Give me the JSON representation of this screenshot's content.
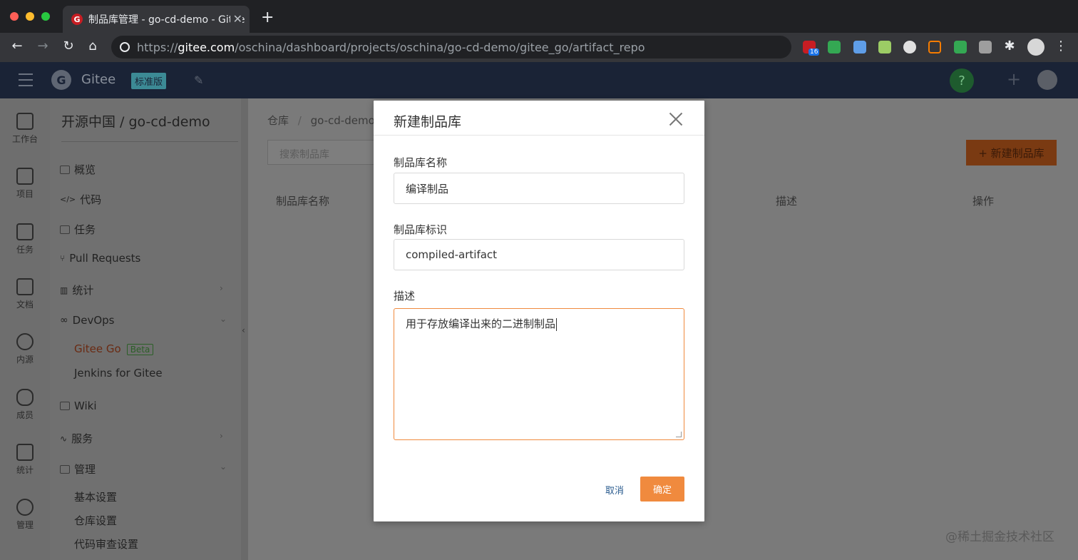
{
  "browser": {
    "tab_title": "制品库管理 - go-cd-demo - Gitee",
    "url_prefix": "https://",
    "url_host": "gitee.com",
    "url_path": "/oschina/dashboard/projects/oschina/go-cd-demo/gitee_go/artifact_repo",
    "ext_badge": "16"
  },
  "appbar": {
    "logo_letter": "G",
    "brand": "Gitee",
    "edition": "标准版",
    "help": "?"
  },
  "rail": [
    {
      "label": "工作台"
    },
    {
      "label": "项目"
    },
    {
      "label": "任务"
    },
    {
      "label": "文档"
    },
    {
      "label": "内源"
    },
    {
      "label": "成员"
    },
    {
      "label": "统计"
    },
    {
      "label": "管理"
    }
  ],
  "sidebar": {
    "project_title": "开源中国 / go-cd-demo",
    "items": {
      "overview": "概览",
      "code": "代码",
      "tasks": "任务",
      "pull_requests": "Pull Requests",
      "stats": "统计",
      "devops": "DevOps",
      "gitee_go": "Gitee Go",
      "beta": "Beta",
      "jenkins": "Jenkins for Gitee",
      "wiki": "Wiki",
      "services": "服务",
      "manage": "管理",
      "basic_settings": "基本设置",
      "repo_settings": "仓库设置",
      "code_review": "代码审查设置"
    }
  },
  "main": {
    "crumb_root": "仓库",
    "crumb_sep": "/",
    "crumb_repo": "go-cd-demo",
    "search_placeholder": "搜索制品库",
    "new_button": "+ 新建制品库",
    "col_name": "制品库名称",
    "col_desc": "描述",
    "col_ops": "操作"
  },
  "modal": {
    "title": "新建制品库",
    "name_label": "制品库名称",
    "name_value": "编译制品",
    "id_label": "制品库标识",
    "id_value": "compiled-artifact",
    "desc_label": "描述",
    "desc_value": "用于存放编译出来的二进制制品",
    "cancel": "取消",
    "confirm": "确定"
  },
  "watermark": "@稀土掘金技术社区"
}
